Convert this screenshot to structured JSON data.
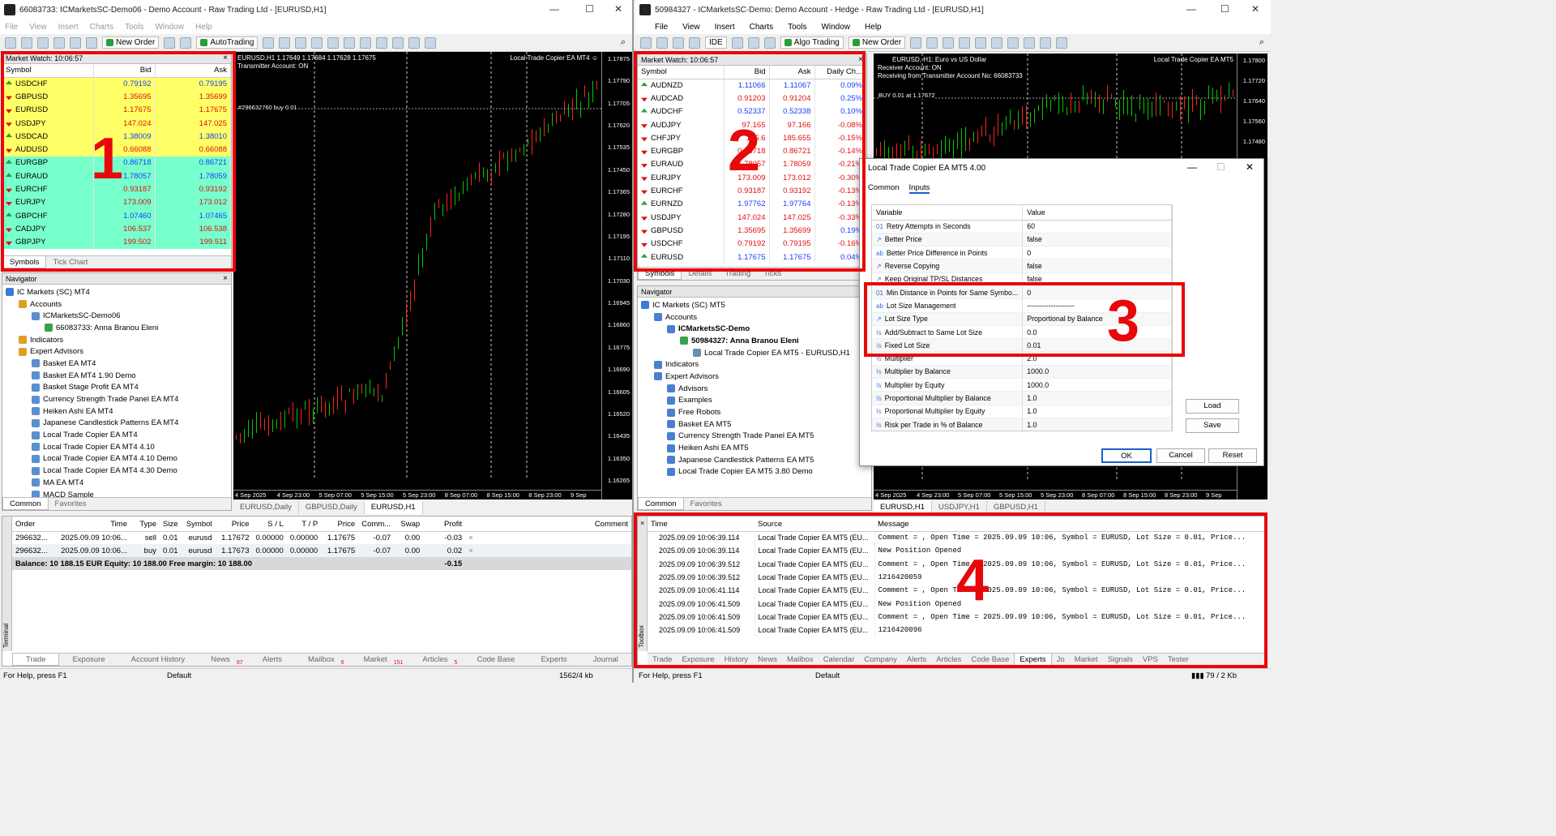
{
  "w1": {
    "title": "66083733: ICMarketsSC-Demo06 - Demo Account - Raw Trading Ltd - [EURUSD,H1]",
    "menu": [
      "File",
      "View",
      "Insert",
      "Charts",
      "Tools",
      "Window",
      "Help"
    ],
    "toolbar": {
      "new_order": "New Order",
      "autotrading": "AutoTrading"
    },
    "market_watch": {
      "header": "Market Watch: 10:06:57",
      "cols": [
        "Symbol",
        "Bid",
        "Ask"
      ],
      "rows": [
        {
          "s": "USDCHF",
          "b": "0.79192",
          "a": "0.79195",
          "d": "up",
          "bg": "#ffff66"
        },
        {
          "s": "GBPUSD",
          "b": "1.35695",
          "a": "1.35699",
          "d": "dn",
          "bg": "#ffff66"
        },
        {
          "s": "EURUSD",
          "b": "1.17675",
          "a": "1.17675",
          "d": "dn",
          "bg": "#ffff66"
        },
        {
          "s": "USDJPY",
          "b": "147.024",
          "a": "147.025",
          "d": "dn",
          "bg": "#ffff66"
        },
        {
          "s": "USDCAD",
          "b": "1.38009",
          "a": "1.38010",
          "d": "up",
          "bg": "#ffff66"
        },
        {
          "s": "AUDUSD",
          "b": "0.66088",
          "a": "0.66088",
          "d": "dn",
          "bg": "#ffff66"
        },
        {
          "s": "EURGBP",
          "b": "0.86718",
          "a": "0.86721",
          "d": "up",
          "bg": "#77ffcc"
        },
        {
          "s": "EURAUD",
          "b": "1.78057",
          "a": "1.78059",
          "d": "up",
          "bg": "#77ffcc"
        },
        {
          "s": "EURCHF",
          "b": "0.93187",
          "a": "0.93192",
          "d": "dn",
          "bg": "#77ffcc"
        },
        {
          "s": "EURJPY",
          "b": "173.009",
          "a": "173.012",
          "d": "dn",
          "bg": "#77ffcc"
        },
        {
          "s": "GBPCHF",
          "b": "1.07460",
          "a": "1.07465",
          "d": "up",
          "bg": "#77ffcc"
        },
        {
          "s": "CADJPY",
          "b": "106.537",
          "a": "106.538",
          "d": "dn",
          "bg": "#77ffcc"
        },
        {
          "s": "GBPJPY",
          "b": "199.502",
          "a": "199.511",
          "d": "dn",
          "bg": "#77ffcc"
        }
      ],
      "tabs": [
        "Symbols",
        "Tick Chart"
      ]
    },
    "navigator": {
      "header": "Navigator",
      "items": [
        {
          "t": "IC Markets (SC) MT4",
          "l": 0
        },
        {
          "t": "Accounts",
          "l": 1
        },
        {
          "t": "ICMarketsSC-Demo06",
          "l": 2
        },
        {
          "t": "66083733: Anna Branou Eleni",
          "l": 3
        },
        {
          "t": "Indicators",
          "l": 1
        },
        {
          "t": "Expert Advisors",
          "l": 1
        },
        {
          "t": "Basket EA MT4",
          "l": 2
        },
        {
          "t": "Basket EA MT4 1.90 Demo",
          "l": 2
        },
        {
          "t": "Basket Stage Profit EA MT4",
          "l": 2
        },
        {
          "t": "Currency Strength Trade Panel EA MT4",
          "l": 2
        },
        {
          "t": "Heiken Ashi EA MT4",
          "l": 2
        },
        {
          "t": "Japanese Candlestick Patterns EA MT4",
          "l": 2
        },
        {
          "t": "Local Trade Copier EA MT4",
          "l": 2
        },
        {
          "t": "Local Trade Copier EA MT4 4.10",
          "l": 2
        },
        {
          "t": "Local Trade Copier EA MT4 4.10 Demo",
          "l": 2
        },
        {
          "t": "Local Trade Copier EA MT4 4.30 Demo",
          "l": 2
        },
        {
          "t": "MA EA MT4",
          "l": 2
        },
        {
          "t": "MACD Sample",
          "l": 2
        }
      ],
      "tabs": [
        "Common",
        "Favorites"
      ]
    },
    "chart": {
      "info1": "EURUSD,H1 1.17649 1.17684 1.17628 1.17675",
      "info2": "Transmitter Account: ON",
      "ea": "Local Trade Copier EA MT4",
      "order_label": "#296632760 buy 0.01",
      "prices": [
        "1.17875",
        "1.17790",
        "1.17705",
        "1.17620",
        "1.17535",
        "1.17450",
        "1.17365",
        "1.17280",
        "1.17195",
        "1.17110",
        "1.17030",
        "1.16945",
        "1.16860",
        "1.16775",
        "1.16690",
        "1.16605",
        "1.16520",
        "1.16435",
        "1.16350",
        "1.16265"
      ],
      "current": "1.17675",
      "times": [
        "4 Sep 2025",
        "4 Sep 23:00",
        "5 Sep 07:00",
        "5 Sep 15:00",
        "5 Sep 23:00",
        "8 Sep 07:00",
        "8 Sep 15:00",
        "8 Sep 23:00",
        "9 Sep 07:00"
      ],
      "tabs": [
        "EURUSD,Daily",
        "GBPUSD,Daily",
        "EURUSD,H1"
      ]
    },
    "terminal": {
      "cols": [
        "Order",
        "Time",
        "Type",
        "Size",
        "Symbol",
        "Price",
        "S / L",
        "T / P",
        "Price",
        "Comm...",
        "Swap",
        "Profit",
        "Comment"
      ],
      "rows": [
        [
          "296632...",
          "2025.09.09 10:06...",
          "sell",
          "0.01",
          "eurusd",
          "1.17672",
          "0.00000",
          "0.00000",
          "1.17675",
          "-0.07",
          "0.00",
          "-0.03"
        ],
        [
          "296632...",
          "2025.09.09 10:06...",
          "buy",
          "0.01",
          "eurusd",
          "1.17673",
          "0.00000",
          "0.00000",
          "1.17675",
          "-0.07",
          "0.00",
          "0.02"
        ]
      ],
      "balance": "Balance: 10 188.15 EUR  Equity: 10 188.00  Free margin: 10 188.00",
      "total": "-0.15",
      "side": "Terminal",
      "tabs": [
        "Trade",
        "Exposure",
        "Account History",
        "News",
        "Alerts",
        "Mailbox",
        "Market",
        "Articles",
        "Code Base",
        "Experts",
        "Journal"
      ],
      "badges": {
        "News": "97",
        "Mailbox": "6",
        "Market": "151",
        "Articles": "5"
      }
    },
    "status": {
      "help": "For Help, press F1",
      "profile": "Default",
      "traffic": "1562/4 kb"
    }
  },
  "w2": {
    "title": "50984327 - ICMarketsSC-Demo: Demo Account - Hedge - Raw Trading Ltd - [EURUSD,H1]",
    "menu": [
      "File",
      "View",
      "Insert",
      "Charts",
      "Tools",
      "Window",
      "Help"
    ],
    "toolbar": {
      "ide": "IDE",
      "algo": "Algo Trading",
      "new_order": "New Order"
    },
    "market_watch": {
      "header": "Market Watch: 10:06:57",
      "cols": [
        "Symbol",
        "Bid",
        "Ask",
        "Daily Ch..."
      ],
      "rows": [
        {
          "s": "AUDNZD",
          "b": "1.11066",
          "a": "1.11067",
          "c": "0.09%",
          "d": "up"
        },
        {
          "s": "AUDCAD",
          "b": "0.91203",
          "a": "0.91204",
          "c": "0.25%",
          "d": "dn"
        },
        {
          "s": "AUDCHF",
          "b": "0.52337",
          "a": "0.52338",
          "c": "0.10%",
          "d": "up"
        },
        {
          "s": "AUDJPY",
          "b": "97.165",
          "a": "97.166",
          "c": "-0.08%",
          "d": "dn"
        },
        {
          "s": "CHFJPY",
          "b": "185.6",
          "a": "185.655",
          "c": "-0.15%",
          "d": "dn"
        },
        {
          "s": "EURGBP",
          "b": "0.86718",
          "a": "0.86721",
          "c": "-0.14%",
          "d": "dn"
        },
        {
          "s": "EURAUD",
          "b": "1.78057",
          "a": "1.78059",
          "c": "-0.21%",
          "d": "dn"
        },
        {
          "s": "EURJPY",
          "b": "173.009",
          "a": "173.012",
          "c": "-0.30%",
          "d": "dn"
        },
        {
          "s": "EURCHF",
          "b": "0.93187",
          "a": "0.93192",
          "c": "-0.13%",
          "d": "dn"
        },
        {
          "s": "EURNZD",
          "b": "1.97762",
          "a": "1.97764",
          "c": "-0.13%",
          "d": "up"
        },
        {
          "s": "USDJPY",
          "b": "147.024",
          "a": "147.025",
          "c": "-0.33%",
          "d": "dn"
        },
        {
          "s": "GBPUSD",
          "b": "1.35695",
          "a": "1.35699",
          "c": "0.19%",
          "d": "dn"
        },
        {
          "s": "USDCHF",
          "b": "0.79192",
          "a": "0.79195",
          "c": "-0.16%",
          "d": "dn"
        },
        {
          "s": "EURUSD",
          "b": "1.17675",
          "a": "1.17675",
          "c": "0.04%",
          "d": "up"
        }
      ],
      "tabs": [
        "Symbols",
        "Details",
        "Trading",
        "Ticks"
      ]
    },
    "navigator": {
      "header": "Navigator",
      "items": [
        {
          "t": "IC Markets (SC) MT5",
          "l": 0
        },
        {
          "t": "Accounts",
          "l": 1
        },
        {
          "t": "ICMarketsSC-Demo",
          "l": 2,
          "b": true
        },
        {
          "t": "50984327: Anna Branou Eleni",
          "l": 3,
          "b": true
        },
        {
          "t": "Local Trade Copier EA MT5 - EURUSD,H1",
          "l": 4
        },
        {
          "t": "Indicators",
          "l": 1
        },
        {
          "t": "Expert Advisors",
          "l": 1
        },
        {
          "t": "Advisors",
          "l": 2
        },
        {
          "t": "Examples",
          "l": 2
        },
        {
          "t": "Free Robots",
          "l": 2
        },
        {
          "t": "Basket EA MT5",
          "l": 2
        },
        {
          "t": "Currency Strength Trade Panel EA MT5",
          "l": 2
        },
        {
          "t": "Heiken Ashi EA MT5",
          "l": 2
        },
        {
          "t": "Japanese Candlestick Patterns EA MT5",
          "l": 2
        },
        {
          "t": "Local Trade Copier EA MT5 3.80 Demo",
          "l": 2
        }
      ],
      "tabs": [
        "Common",
        "Favorites"
      ]
    },
    "chart": {
      "info1": "EURUSD, H1:  Euro vs US Dollar",
      "info2": "Receiver Account: ON",
      "info3": "Receiving from Transmitter Account No: 66083733",
      "ea": "Local Trade Copier EA MT5",
      "order_label": "BUY 0.01 at 1.17672",
      "prices": [
        "1.17800",
        "1.17720",
        "1.17640",
        "1.17560",
        "1.17480"
      ],
      "current": "1.17675",
      "times": [
        "4 Sep 2025",
        "4 Sep 23:00",
        "5 Sep 07:00",
        "5 Sep 15:00",
        "5 Sep 23:00",
        "8 Sep 07:00",
        "8 Sep 15:00",
        "8 Sep 23:00",
        "9 Sep 07:00"
      ],
      "tabs": [
        "EURUSD,H1",
        "USDJPY,H1",
        "GBPUSD,H1"
      ]
    },
    "dialog": {
      "title": "Local Trade Copier EA MT5 4.00",
      "tabs": [
        "Common",
        "Inputs"
      ],
      "cols": [
        "Variable",
        "Value"
      ],
      "rows": [
        {
          "tag": "01",
          "v": "Retry Attempts in Seconds",
          "x": "60"
        },
        {
          "tag": "↗",
          "v": "Better Price",
          "x": "false"
        },
        {
          "tag": "ab",
          "v": "Better Price Difference in Points",
          "x": "0"
        },
        {
          "tag": "↗",
          "v": "Reverse Copying",
          "x": "false"
        },
        {
          "tag": "↗",
          "v": "Keep Original TP/SL Distances",
          "x": "false"
        },
        {
          "tag": "01",
          "v": "Min Distance in Points for Same Symbo...",
          "x": "0"
        },
        {
          "tag": "ab",
          "v": "Lot Size Management",
          "x": "--------------------"
        },
        {
          "tag": "↗",
          "v": "Lot Size Type",
          "x": "Proportional by Balance"
        },
        {
          "tag": "½",
          "v": "Add/Subtract to Same Lot Size",
          "x": "0.0"
        },
        {
          "tag": "½",
          "v": "Fixed Lot Size",
          "x": "0.01"
        },
        {
          "tag": "½",
          "v": "Multiplier",
          "x": "2.0"
        },
        {
          "tag": "½",
          "v": "Multiplier by Balance",
          "x": "1000.0"
        },
        {
          "tag": "½",
          "v": "Multiplier by Equity",
          "x": "1000.0"
        },
        {
          "tag": "½",
          "v": "Proportional Multiplier by Balance",
          "x": "1.0"
        },
        {
          "tag": "½",
          "v": "Proportional Multiplier by Equity",
          "x": "1.0"
        },
        {
          "tag": "½",
          "v": "Risk per Trade in % of Balance",
          "x": "1.0"
        }
      ],
      "load": "Load",
      "save": "Save",
      "ok": "OK",
      "cancel": "Cancel",
      "reset": "Reset"
    },
    "log": {
      "cols": [
        "Time",
        "Source",
        "Message"
      ],
      "rows": [
        [
          "2025.09.09 10:06:39.114",
          "Local Trade Copier EA MT5 (EU...",
          "Comment = , Open Time = 2025.09.09 10:06, Symbol = EURUSD, Lot Size = 0.01, Price..."
        ],
        [
          "2025.09.09 10:06:39.114",
          "Local Trade Copier EA MT5 (EU...",
          "New Position Opened"
        ],
        [
          "2025.09.09 10:06:39.512",
          "Local Trade Copier EA MT5 (EU...",
          "Comment = , Open Time = 2025.09.09 10:06, Symbol = EURUSD, Lot Size = 0.01, Price..."
        ],
        [
          "2025.09.09 10:06:39.512",
          "Local Trade Copier EA MT5 (EU...",
          "1216420059"
        ],
        [
          "2025.09.09 10:06:41.114",
          "Local Trade Copier EA MT5 (EU...",
          "Comment = , Open Time = 2025.09.09 10:06, Symbol = EURUSD, Lot Size = 0.01, Price..."
        ],
        [
          "2025.09.09 10:06:41.509",
          "Local Trade Copier EA MT5 (EU...",
          "New Position Opened"
        ],
        [
          "2025.09.09 10:06:41.509",
          "Local Trade Copier EA MT5 (EU...",
          "Comment = , Open Time = 2025.09.09 10:06, Symbol = EURUSD, Lot Size = 0.01, Price..."
        ],
        [
          "2025.09.09 10:06:41.509",
          "Local Trade Copier EA MT5 (EU...",
          "1216420096"
        ]
      ],
      "side": "Toolbox",
      "tabs": [
        "Trade",
        "Exposure",
        "History",
        "News",
        "Mailbox",
        "Calendar",
        "Company",
        "Alerts",
        "Articles",
        "Code Base",
        "Experts",
        "Jo",
        "Market",
        "Signals",
        "VPS",
        "Tester"
      ]
    },
    "status": {
      "help": "For Help, press F1",
      "profile": "Default",
      "traffic": "79 / 2 Kb"
    }
  },
  "annotations": [
    "1",
    "2",
    "3",
    "4"
  ],
  "colors": {
    "highlight": "#e8070a",
    "bull": "#00c800",
    "bear": "#ff2020"
  }
}
